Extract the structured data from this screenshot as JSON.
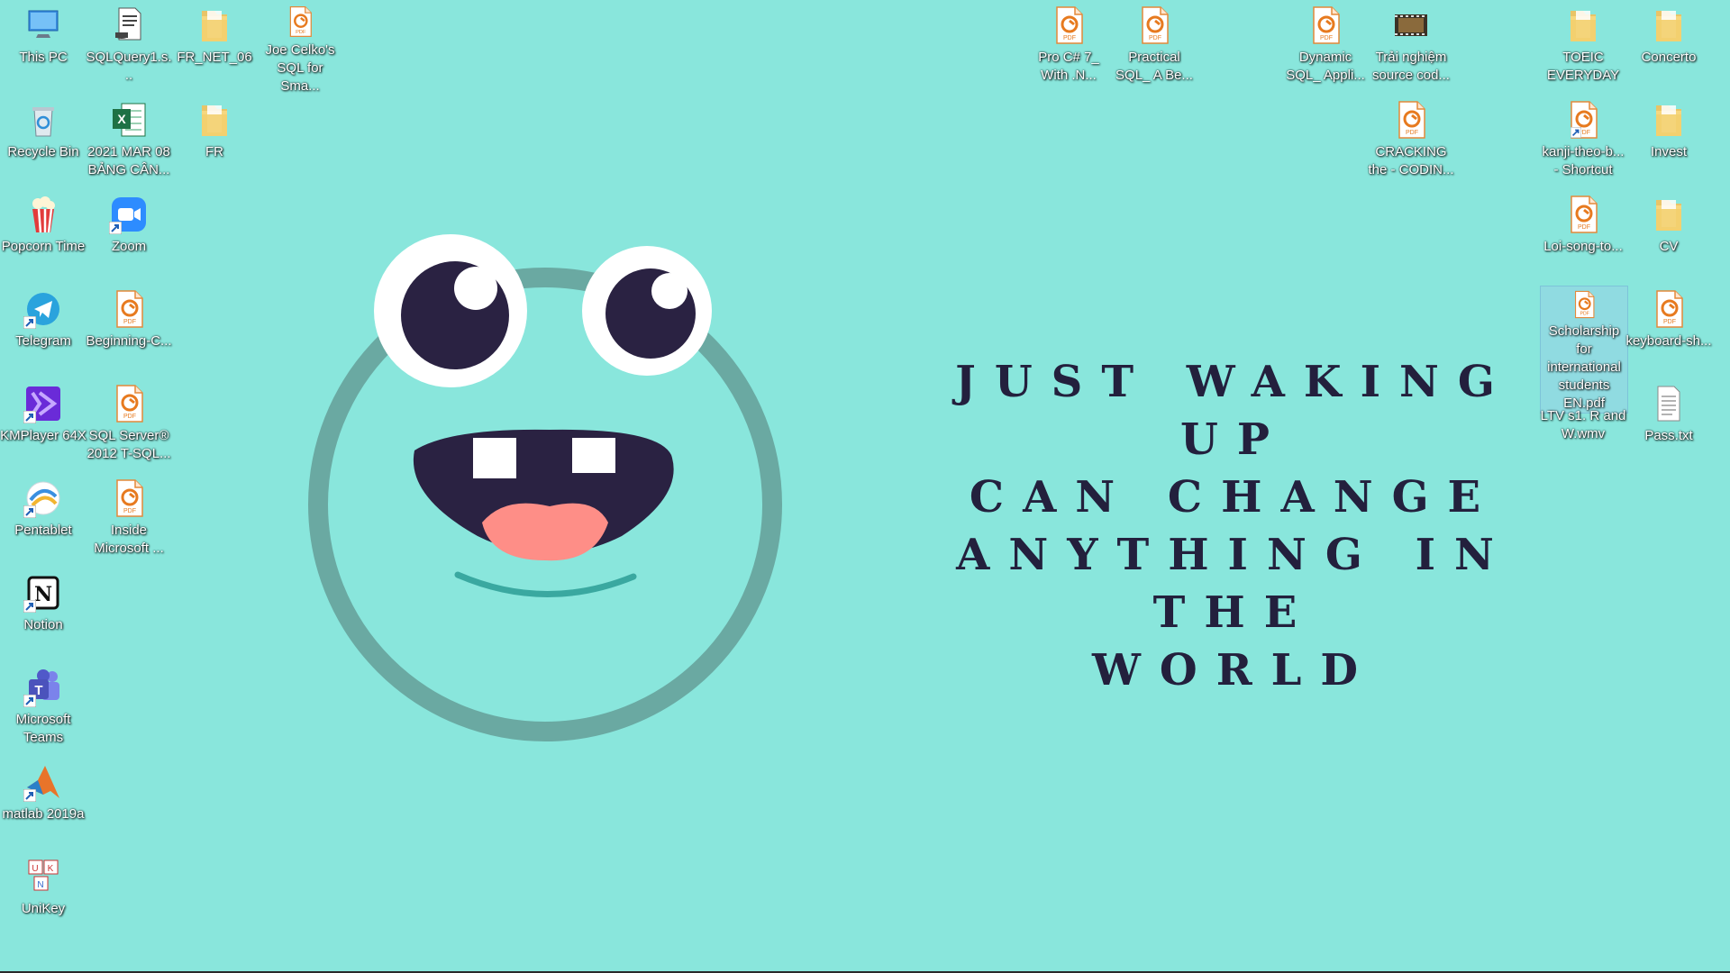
{
  "wallpaper": {
    "quote_lines": [
      "JUST WAKING UP",
      "CAN CHANGE",
      "ANYTHING IN THE",
      "WORLD"
    ],
    "background_color": "#89e6dc",
    "accent_dark": "#2a2242",
    "ring_color": "#6aa9a2"
  },
  "desktop_icons": {
    "this_pc": {
      "label": "This PC",
      "icon": "computer-icon"
    },
    "sqlquery": {
      "label": "SQLQuery1.s...",
      "icon": "sql-file-icon"
    },
    "fr_net_06": {
      "label": "FR_NET_06",
      "icon": "folder-icon"
    },
    "joe_celko": {
      "label": "Joe Celko's SQL for Sma...",
      "icon": "pdf-icon"
    },
    "recycle_bin": {
      "label": "Recycle Bin",
      "icon": "recycle-bin-icon"
    },
    "excel_2021": {
      "label": "2021 MAR 08 BẢNG CÂN...",
      "icon": "excel-icon"
    },
    "fr": {
      "label": "FR",
      "icon": "folder-icon"
    },
    "popcorn": {
      "label": "Popcorn Time",
      "icon": "popcorn-icon"
    },
    "zoom": {
      "label": "Zoom",
      "icon": "zoom-icon"
    },
    "telegram": {
      "label": "Telegram",
      "icon": "telegram-icon"
    },
    "beginning_c": {
      "label": "Beginning-C...",
      "icon": "pdf-icon"
    },
    "kmplayer": {
      "label": "KMPlayer 64X",
      "icon": "kmplayer-icon"
    },
    "sql_server": {
      "label": "SQL Server® 2012 T-SQL...",
      "icon": "pdf-icon"
    },
    "pentablet": {
      "label": "Pentablet",
      "icon": "pentablet-icon"
    },
    "inside_microsoft": {
      "label": "Inside Microsoft ...",
      "icon": "pdf-icon"
    },
    "notion": {
      "label": "Notion",
      "icon": "notion-icon"
    },
    "teams": {
      "label": "Microsoft Teams",
      "icon": "teams-icon"
    },
    "matlab": {
      "label": "matlab 2019a",
      "icon": "matlab-icon"
    },
    "unikey": {
      "label": "UniKey",
      "icon": "unikey-icon"
    },
    "pro_csharp": {
      "label": "Pro C# 7_ With .N...",
      "icon": "pdf-icon"
    },
    "practical_sql": {
      "label": "Practical SQL_ A Be...",
      "icon": "pdf-icon"
    },
    "dynamic_sql": {
      "label": "Dynamic SQL_ Appli...",
      "icon": "pdf-icon"
    },
    "trai_nghiem": {
      "label": "Trải nghiệm source cod...",
      "icon": "video-file-icon"
    },
    "cracking": {
      "label": "CRACKING the - CODIN...",
      "icon": "pdf-icon"
    },
    "toeic": {
      "label": "TOEIC EVERYDAY",
      "icon": "folder-icon"
    },
    "concerto": {
      "label": "Concerto",
      "icon": "folder-icon"
    },
    "kanji": {
      "label": "kanji-theo-b... - Shortcut",
      "icon": "pdf-icon"
    },
    "invest": {
      "label": "Invest",
      "icon": "folder-icon"
    },
    "loi_song": {
      "label": "Loi-song-to...",
      "icon": "pdf-icon"
    },
    "cv": {
      "label": "CV",
      "icon": "folder-icon"
    },
    "scholarship": {
      "label": "Scholarship for international students EN.pdf",
      "icon": "pdf-icon"
    },
    "keyboard": {
      "label": "keyboard-sh...",
      "icon": "pdf-icon"
    },
    "ltv": {
      "label": "LTV s1. R and W.wmv",
      "icon": "video-file-icon"
    },
    "pass_txt": {
      "label": "Pass.txt",
      "icon": "text-file-icon"
    }
  }
}
